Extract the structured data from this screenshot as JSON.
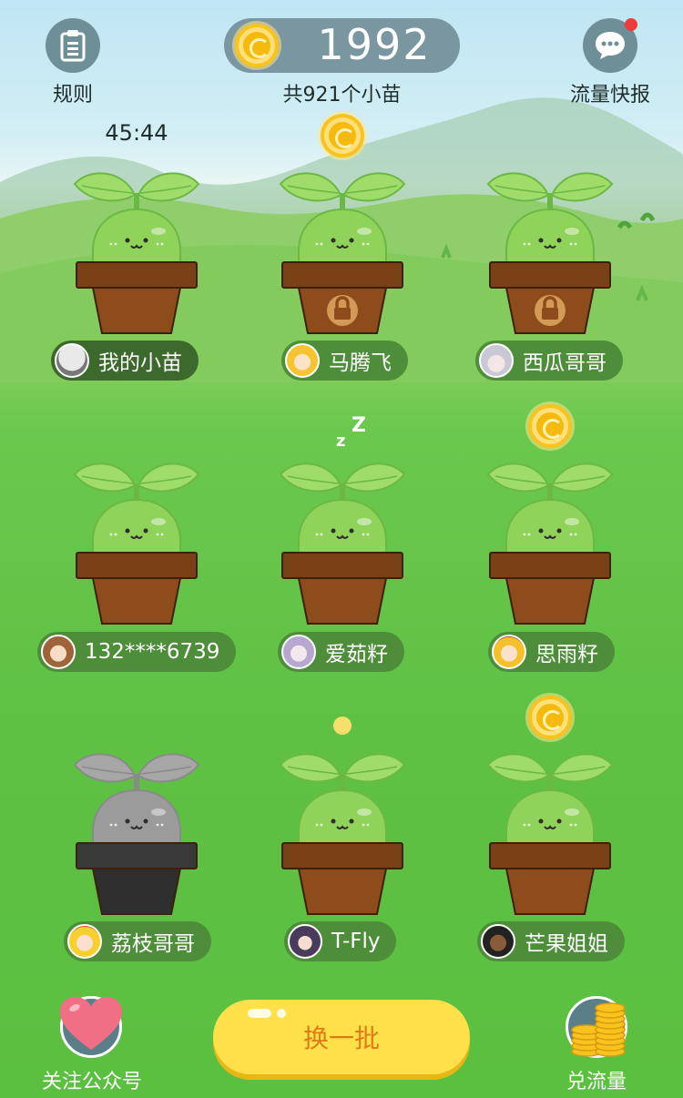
{
  "header": {
    "rules_label": "规则",
    "coin_amount": "1992",
    "seedling_total": "共921个小苗",
    "news_label": "流量快报",
    "news_has_notification": true
  },
  "timer_text": "45:44",
  "sleep_text_1": "z",
  "sleep_text_2": "Z",
  "plants": [
    {
      "name": "我的小苗",
      "status": "timer",
      "locked": false,
      "withered": false
    },
    {
      "name": "马腾飞",
      "status": "coin",
      "locked": true,
      "withered": false
    },
    {
      "name": "西瓜哥哥",
      "status": "none",
      "locked": true,
      "withered": false
    },
    {
      "name": "132****6739",
      "status": "none",
      "locked": false,
      "withered": false
    },
    {
      "name": "爱茹籽",
      "status": "sleeping",
      "locked": false,
      "withered": false
    },
    {
      "name": "思雨籽",
      "status": "coin",
      "locked": false,
      "withered": false
    },
    {
      "name": "荔枝哥哥",
      "status": "none",
      "locked": false,
      "withered": true
    },
    {
      "name": "T-Fly",
      "status": "seed",
      "locked": false,
      "withered": false
    },
    {
      "name": "芒果姐姐",
      "status": "coin",
      "locked": false,
      "withered": false
    }
  ],
  "footer": {
    "follow_label": "关注公众号",
    "refresh_label": "换一批",
    "exchange_label": "兑流量"
  },
  "colors": {
    "leaf": "#9fdc6a",
    "body": "#90d35b",
    "soil": "#7a4016",
    "pot": "#8e4c1c",
    "withered": "#a7a7a7",
    "coin": "#f8c21f",
    "button": "#fde04a"
  }
}
